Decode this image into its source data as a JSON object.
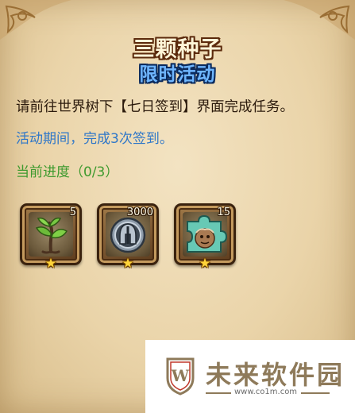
{
  "event": {
    "title": "三颗种子",
    "subtitle": "限时活动",
    "description": "请前往世界树下【七日签到】界面完成任务。",
    "period": "活动期间，完成3次签到。",
    "progress_label": "当前进度（0/3）"
  },
  "rewards": [
    {
      "name": "seedling",
      "count": "5",
      "icon": "sprout-icon",
      "stars": 1
    },
    {
      "name": "helmet-coin",
      "count": "3000",
      "icon": "helmet-coin-icon",
      "stars": 1
    },
    {
      "name": "puzzle-piece",
      "count": "15",
      "icon": "puzzle-piece-icon",
      "stars": 1
    }
  ],
  "watermark": {
    "logo_letter": "W",
    "brand": "未来软件园",
    "url": "www.co1m.com"
  },
  "colors": {
    "title_fill": "#fff6d8",
    "subtitle_fill": "#6fb6ff",
    "description": "#2b1a0c",
    "period": "#2f77c8",
    "progress": "#3e9a2e",
    "star": "#ffd43a"
  }
}
